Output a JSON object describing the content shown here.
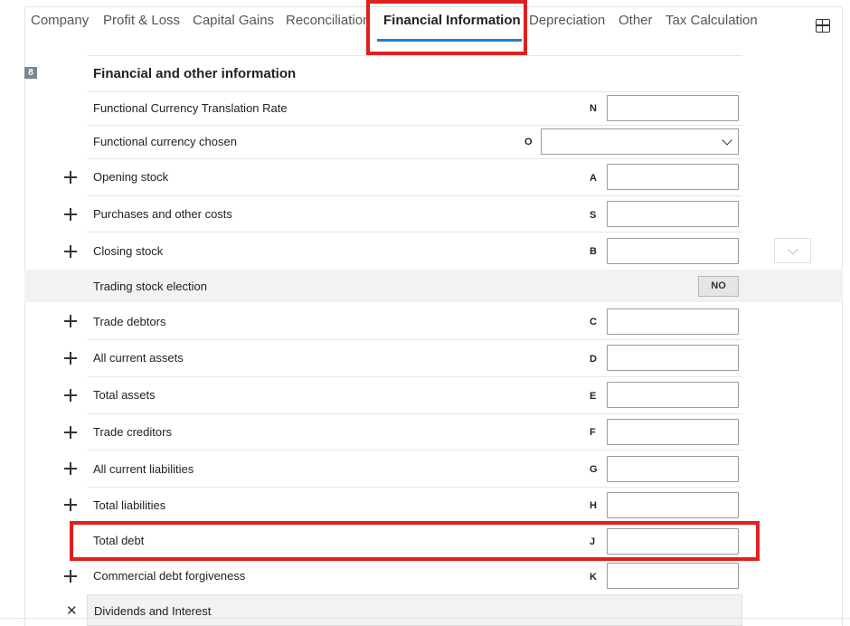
{
  "tabs": [
    {
      "label": "Company",
      "active": false
    },
    {
      "label": "Profit & Loss",
      "active": false
    },
    {
      "label": "Capital Gains",
      "active": false
    },
    {
      "label": "Reconciliation",
      "active": false
    },
    {
      "label": "Financial Information",
      "active": true
    },
    {
      "label": "Depreciation",
      "active": false
    },
    {
      "label": "Other",
      "active": false
    },
    {
      "label": "Tax Calculation",
      "active": false
    }
  ],
  "toolbar": {
    "layout_icon": "grid-layout-icon"
  },
  "section": {
    "number": "8",
    "title": "Financial and other information"
  },
  "rows": {
    "functional_rate": {
      "label": "Functional Currency Translation Rate",
      "code": "N",
      "value": ""
    },
    "functional_currency": {
      "label": "Functional currency chosen",
      "code": "O",
      "value": ""
    },
    "opening_stock": {
      "label": "Opening stock",
      "code": "A",
      "value": ""
    },
    "purchases": {
      "label": "Purchases and other costs",
      "code": "S",
      "value": ""
    },
    "closing_stock": {
      "label": "Closing stock",
      "code": "B",
      "value": ""
    },
    "trading_stock_election": {
      "label": "Trading stock election",
      "toggle": "NO"
    },
    "trade_debtors": {
      "label": "Trade debtors",
      "code": "C",
      "value": ""
    },
    "current_assets": {
      "label": "All current assets",
      "code": "D",
      "value": ""
    },
    "total_assets": {
      "label": "Total assets",
      "code": "E",
      "value": ""
    },
    "trade_creditors": {
      "label": "Trade creditors",
      "code": "F",
      "value": ""
    },
    "current_liabilities": {
      "label": "All current liabilities",
      "code": "G",
      "value": ""
    },
    "total_liabilities": {
      "label": "Total liabilities",
      "code": "H",
      "value": ""
    },
    "total_debt": {
      "label": "Total debt",
      "code": "J",
      "value": ""
    },
    "debt_forgiveness": {
      "label": "Commercial debt forgiveness",
      "code": "K",
      "value": ""
    },
    "dividends": {
      "label": "Dividends and Interest"
    }
  },
  "colors": {
    "accent": "#1a7fd6",
    "highlight": "#e0201e",
    "band": "#f2f2f2"
  }
}
